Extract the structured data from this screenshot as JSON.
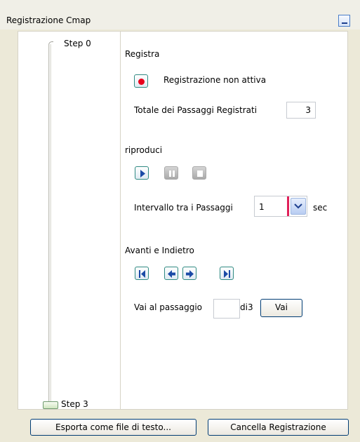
{
  "window": {
    "title": "Registrazione Cmap"
  },
  "slider": {
    "top_label": "Step 0",
    "bottom_label": "Step 3"
  },
  "record": {
    "heading": "Registra",
    "status": "Registrazione non attiva",
    "total_label": "Totale dei Passaggi Registrati",
    "total_value": "3"
  },
  "playback": {
    "heading": "riproduci",
    "interval_label": "Intervallo tra i Passaggi",
    "interval_value": "1",
    "interval_unit": "sec"
  },
  "navigation": {
    "heading": "Avanti e Indietro",
    "goto_label": "Vai al passaggio",
    "goto_value": "",
    "of_label": "di3",
    "go_button": "Vai"
  },
  "footer": {
    "export_button": "Esporta come file di testo...",
    "clear_button": "Cancella Registrazione"
  },
  "colors": {
    "record_dot": "#e8001c",
    "accent_border": "#2f8a82",
    "play_icon": "#1b4aa6",
    "divider_red": "#e0205a"
  }
}
